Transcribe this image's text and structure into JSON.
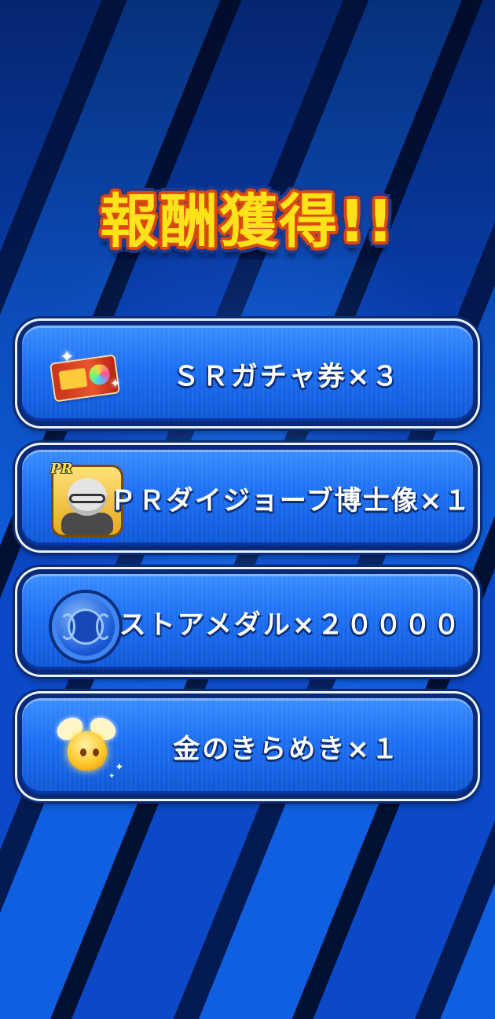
{
  "title": "報酬獲得!!",
  "rewards": [
    {
      "label": "ＳＲガチャ券×３",
      "icon": "gacha-ticket-icon"
    },
    {
      "label": "ＰＲダイジョーブ博士像×１",
      "icon": "pr-statue-icon"
    },
    {
      "label": "ストアメダル×２００００",
      "icon": "store-medal-icon"
    },
    {
      "label": "金のきらめき×１",
      "icon": "gold-kirameki-icon"
    }
  ],
  "badges": {
    "pr_badge": "PR"
  },
  "colors": {
    "title_fill": "#ffe21a",
    "title_outline": "#d9480f",
    "button_blue": "#1d6ff2"
  }
}
